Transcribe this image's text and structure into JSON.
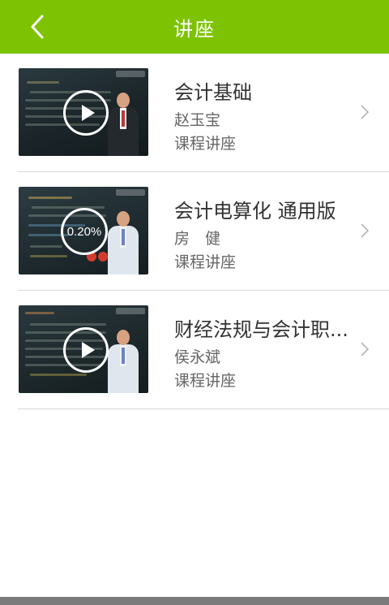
{
  "header": {
    "title": "讲座",
    "back_icon": "chevron-left-icon",
    "background_color": "#7dc303"
  },
  "lectures": [
    {
      "title": "会计基础",
      "teacher": "赵玉宝",
      "category": "课程讲座",
      "thumbnail_overlay": "play-icon",
      "progress_label": ""
    },
    {
      "title": "会计电算化 通用版",
      "teacher": "房　健",
      "category": "课程讲座",
      "thumbnail_overlay": "progress",
      "progress_label": "0.20%"
    },
    {
      "title": "财经法规与会计职...",
      "teacher": "侯永斌",
      "category": "课程讲座",
      "thumbnail_overlay": "play-icon",
      "progress_label": ""
    }
  ]
}
